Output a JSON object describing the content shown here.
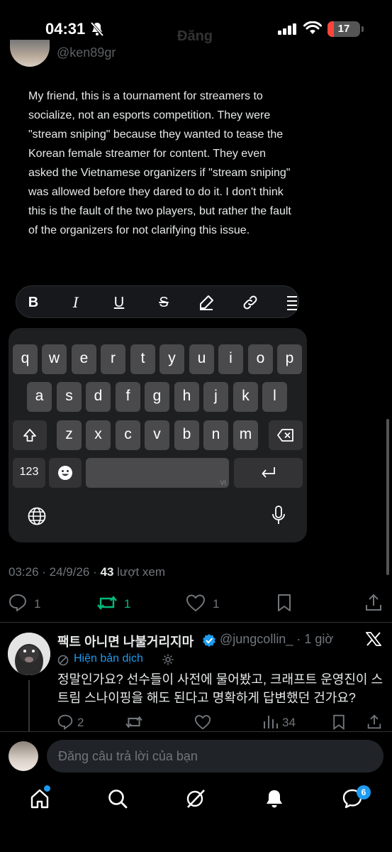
{
  "status_bar": {
    "time": "04:31",
    "battery_level": "17",
    "header_title": "Đăng",
    "top_handle": "@ken89gr"
  },
  "reply_draft": {
    "text": "My friend, this is a tournament for streamers to socialize, not an esports competition. They were \"stream sniping\" because they wanted to tease the Korean female streamer for content. They even asked the Vietnamese organizers if \"stream sniping\" was allowed before they dared to do it. I don't think this is the fault of the two players, but rather the fault of the organizers for not clarifying this issue."
  },
  "format_bar": {
    "bold": "B",
    "italic": "I",
    "underline": "U",
    "strike": "S",
    "icons": [
      "highlight-pen-icon",
      "link-icon",
      "list-icon"
    ]
  },
  "keyboard": {
    "row1": [
      "q",
      "w",
      "e",
      "r",
      "t",
      "y",
      "u",
      "i",
      "o",
      "p"
    ],
    "row2": [
      "a",
      "s",
      "d",
      "f",
      "g",
      "h",
      "j",
      "k",
      "l"
    ],
    "row3": [
      "z",
      "x",
      "c",
      "v",
      "b",
      "n",
      "m"
    ],
    "numbers_key": "123",
    "space_lang": "VI"
  },
  "post_meta": {
    "time": "03:26",
    "date": "24/9/26",
    "views": "43",
    "views_label": "lượt xem"
  },
  "post_actions": {
    "replies": "1",
    "reposts": "1",
    "likes": "1"
  },
  "reply": {
    "name": "팩트 아니면 나불거리지마",
    "handle": "@jungcollin_",
    "time": "· 1 giờ",
    "translate_label": "Hiện bản dịch",
    "body": "정말인가요? 선수들이 사전에 물어봤고, 크래프트 운영진이 스트림 스나이핑을 해도 된다고 명확하게 답변했던 건가요?",
    "replies": "2",
    "views": "34"
  },
  "compose": {
    "placeholder": "Đăng câu trả lời của bạn"
  },
  "bottom_nav": {
    "messages_badge": "6"
  },
  "colors": {
    "accent": "#1d9bf0",
    "repost_green": "#00ba7c",
    "muted": "#71767b"
  }
}
